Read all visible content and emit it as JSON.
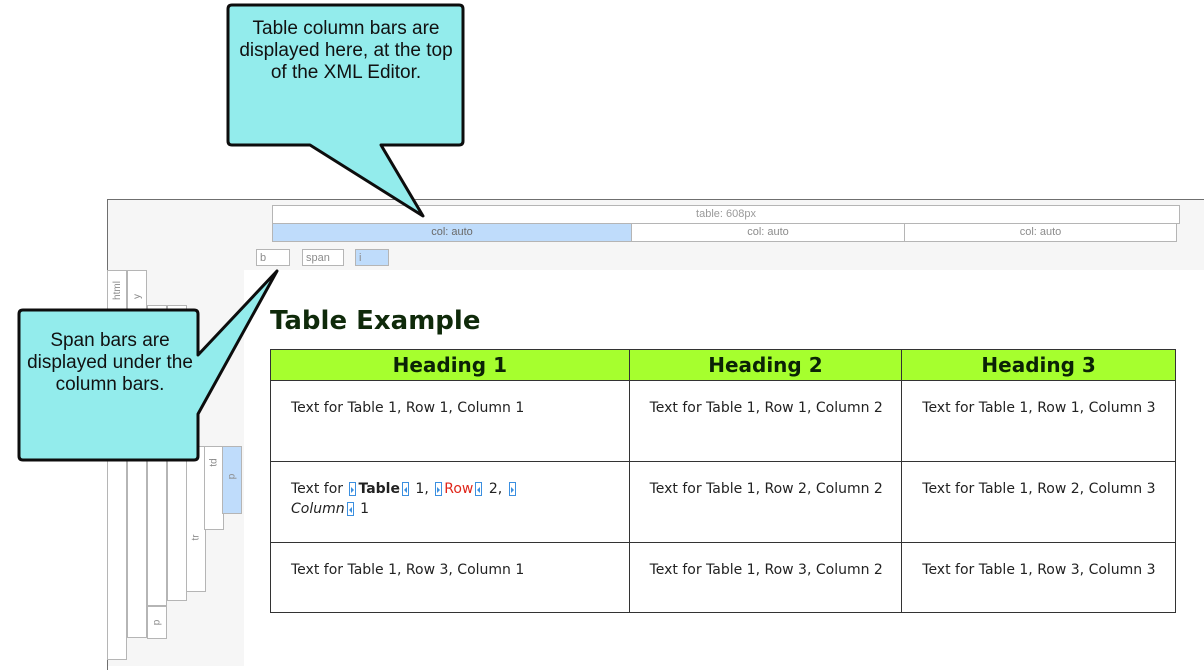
{
  "editor": {
    "table_bar_label": "table: 608px",
    "column_bars": [
      "col: auto",
      "col: auto",
      "col: auto"
    ],
    "span_bars": [
      "b",
      "span",
      "i"
    ],
    "structure_bars": [
      "html",
      "y",
      "tr",
      "td",
      "p",
      "p"
    ]
  },
  "document": {
    "title": "Table Example",
    "table": {
      "headers": [
        "Heading 1",
        "Heading 2",
        "Heading 3"
      ],
      "rows": [
        [
          "Text for Table 1, Row 1, Column 1",
          "Text for Table 1, Row 1, Column 2",
          "Text for Table 1, Row 1, Column 3"
        ],
        [
          "Text for Table 1, Row 2, Column 1",
          "Text for Table 1, Row 2, Column 2",
          "Text for Table 1, Row 2, Column 3"
        ],
        [
          "Text for Table 1, Row 3, Column 1",
          "Text for Table 1, Row 3, Column 2",
          "Text for Table 1, Row 3, Column 3"
        ]
      ],
      "row2_col1_parts": {
        "text_for": "Text for ",
        "bold_word": "Table",
        "after_bold": " 1, ",
        "red_word": "Row",
        "after_red": " 2, ",
        "italic_word": "Column",
        "after_italic": " 1"
      }
    }
  },
  "callouts": {
    "top": "Table column bars are displayed here, at the top of the XML Editor.",
    "left": "Span bars are displayed under the column bars."
  },
  "colors": {
    "callout_fill": "#93ecec",
    "header_fill": "#a6ff2e",
    "active_bar": "#bfdcfb"
  }
}
